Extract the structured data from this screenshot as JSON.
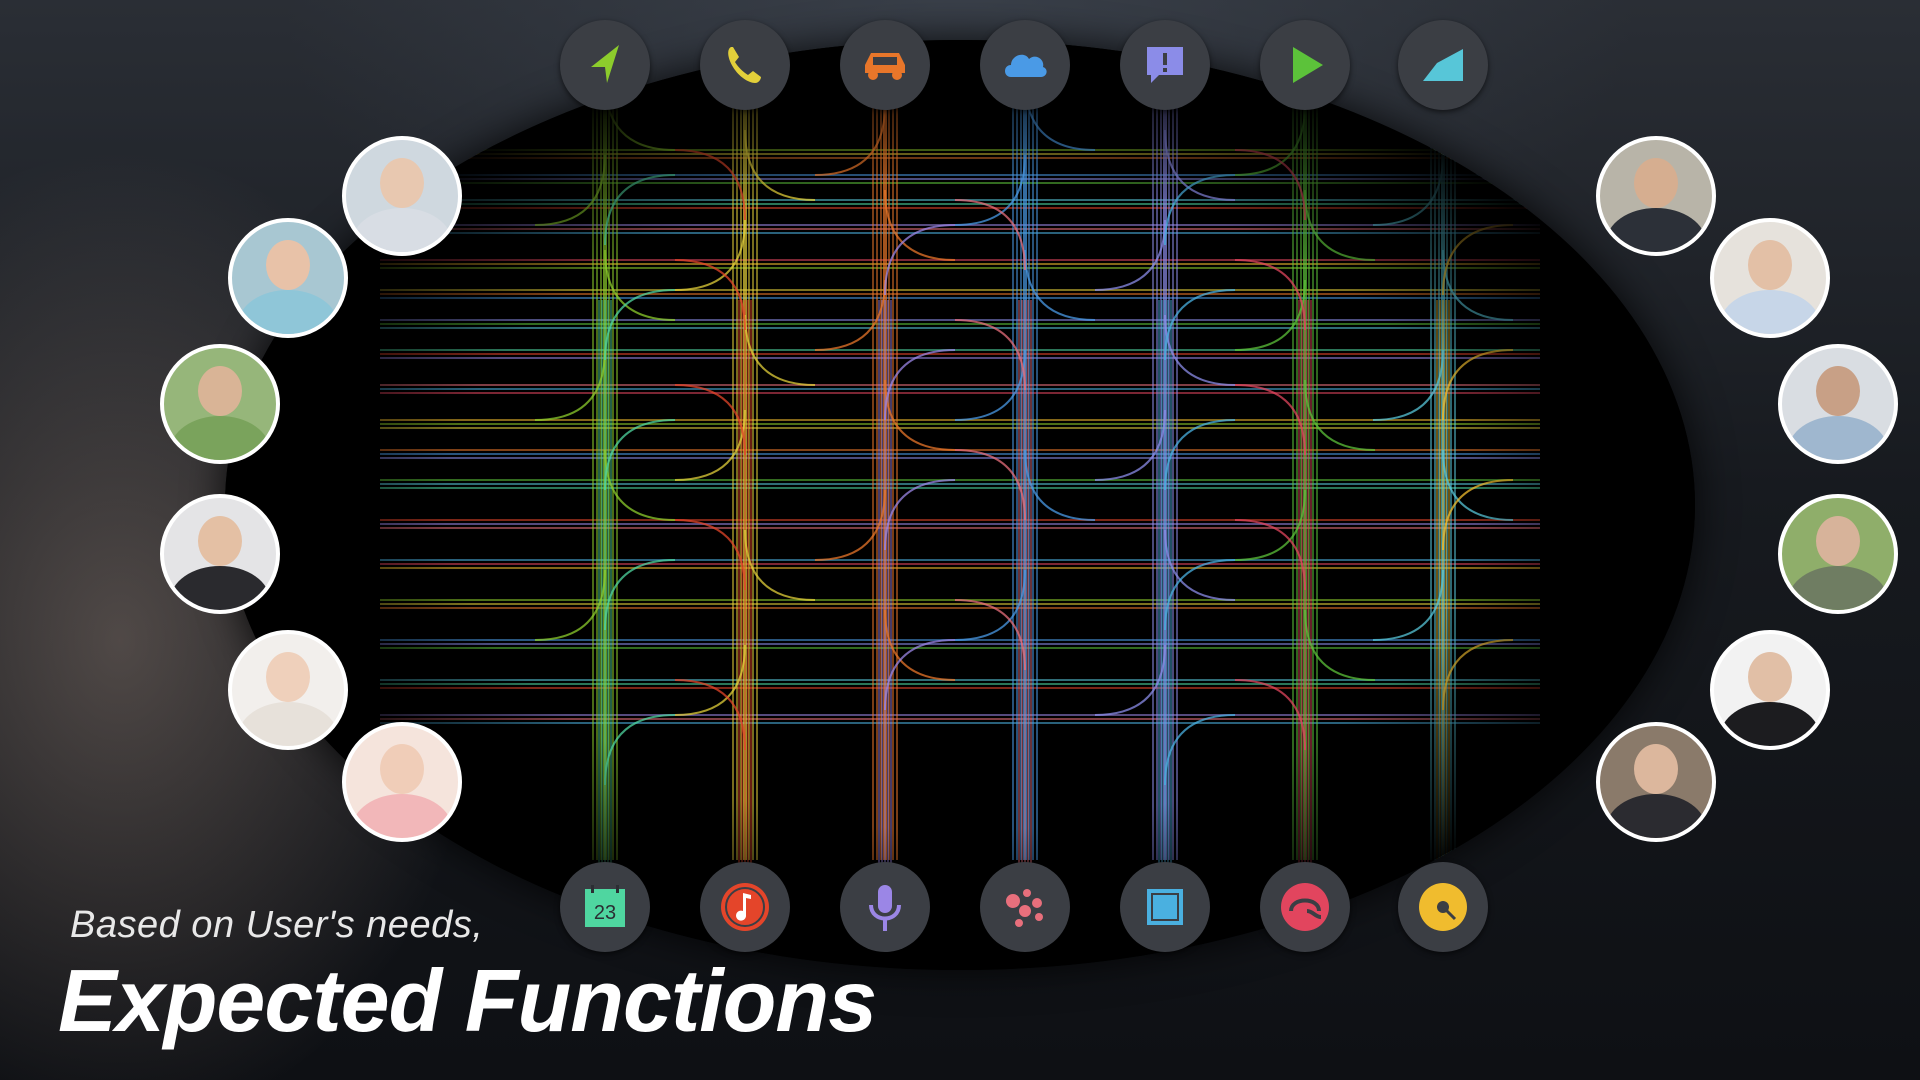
{
  "subtitle": "Based on User's needs,",
  "title": "Expected Functions",
  "top_icons": [
    {
      "name": "navigation-arrow-icon",
      "color": "#8ccc2c"
    },
    {
      "name": "phone-icon",
      "color": "#e2cf3a"
    },
    {
      "name": "car-icon",
      "color": "#e8762a"
    },
    {
      "name": "cloud-icon",
      "color": "#4a9ae6"
    },
    {
      "name": "alert-message-icon",
      "color": "#8b8ce8"
    },
    {
      "name": "play-icon",
      "color": "#5cc23a"
    },
    {
      "name": "signal-ramp-icon",
      "color": "#57c6d8"
    }
  ],
  "bottom_icons": [
    {
      "name": "calendar-icon",
      "color": "#4fd6a0",
      "label": "23"
    },
    {
      "name": "music-note-icon",
      "color": "#e4452a"
    },
    {
      "name": "microphone-icon",
      "color": "#9b86e6"
    },
    {
      "name": "dots-cluster-icon",
      "color": "#e86f7c"
    },
    {
      "name": "square-window-icon",
      "color": "#4ab0e0"
    },
    {
      "name": "headset-icon",
      "color": "#e2455e"
    },
    {
      "name": "vinyl-disc-icon",
      "color": "#f0bc2e"
    }
  ],
  "people_left": [
    {
      "name": "person-young-man",
      "skin": "#e8c8b0",
      "cloth": "#d8dde4"
    },
    {
      "name": "person-two-women",
      "skin": "#e8c2a8",
      "cloth": "#8fc6d8"
    },
    {
      "name": "person-family",
      "skin": "#d9b496",
      "cloth": "#7aa35c"
    },
    {
      "name": "person-businesswoman",
      "skin": "#e4c0a4",
      "cloth": "#2a2a2e"
    },
    {
      "name": "person-mother-baby",
      "skin": "#efd0bb",
      "cloth": "#e7e1da"
    },
    {
      "name": "person-mother-kiss",
      "skin": "#f0cdb8",
      "cloth": "#f2b7b9"
    }
  ],
  "people_right": [
    {
      "name": "person-businessman-meeting",
      "skin": "#d6ae90",
      "cloth": "#2c3038"
    },
    {
      "name": "person-couple",
      "skin": "#e3c0a6",
      "cloth": "#c7d6e8"
    },
    {
      "name": "person-men-laughing",
      "skin": "#c8a086",
      "cloth": "#9fb7cf"
    },
    {
      "name": "person-elderly-man",
      "skin": "#d7b39a",
      "cloth": "#6f7d62"
    },
    {
      "name": "person-older-woman",
      "skin": "#e1bfa6",
      "cloth": "#1c1c1f"
    },
    {
      "name": "person-woman-smiling",
      "skin": "#dcb79d",
      "cloth": "#2b2b30"
    }
  ]
}
